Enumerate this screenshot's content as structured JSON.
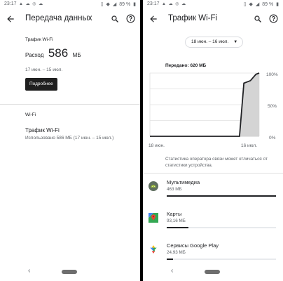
{
  "left": {
    "status": {
      "time": "23:17",
      "battery": "89 %"
    },
    "title": "Передача данных",
    "section_label": "Трафик Wi-Fi",
    "usage_prefix": "Расход",
    "usage_value": "586",
    "usage_unit": "МБ",
    "period": "17 июн. – 15 июл.",
    "details_button": "Подробнее",
    "wifi_header": "Wi-Fi",
    "wifi_item_title": "Трафик Wi-Fi",
    "wifi_item_subtitle": "Использовано 586 МБ (17 июн. – 15 июл.)",
    "nav_back": "‹"
  },
  "right": {
    "status": {
      "time": "23:17",
      "battery": "89 %"
    },
    "title": "Трафик Wi-Fi",
    "date_range": "18 июн. – 16 июл.",
    "used_label": "Передано: 620 МБ",
    "note": "Статистика оператора связи может отличаться от статистики устройства.",
    "nav_back": "‹",
    "apps": [
      {
        "name": "Мультимедиа",
        "size": "463 МБ",
        "fraction": 1.0,
        "icon": "android-icon"
      },
      {
        "name": "Карты",
        "size": "93,16 МБ",
        "fraction": 0.2,
        "icon": "maps-icon"
      },
      {
        "name": "Сервисы Google Play",
        "size": "24,93 МБ",
        "fraction": 0.055,
        "icon": "google-play-services-icon"
      }
    ]
  },
  "chart_data": {
    "type": "area",
    "x": [
      "18 июн.",
      "16 июл."
    ],
    "x_ticks": [
      "18 июн.",
      "16 июл."
    ],
    "y_ticks": [
      "100%",
      "50%",
      "0%"
    ],
    "ylim": [
      0,
      100
    ],
    "series": [
      {
        "x_days": [
          0,
          0.82,
          0.86,
          0.92,
          0.97,
          1.0
        ],
        "values": [
          0,
          0,
          84,
          88,
          98,
          100
        ]
      }
    ],
    "colors": {
      "line": "#202124",
      "fill": "#d4d4d4",
      "grid": "#e0e0e0"
    }
  }
}
